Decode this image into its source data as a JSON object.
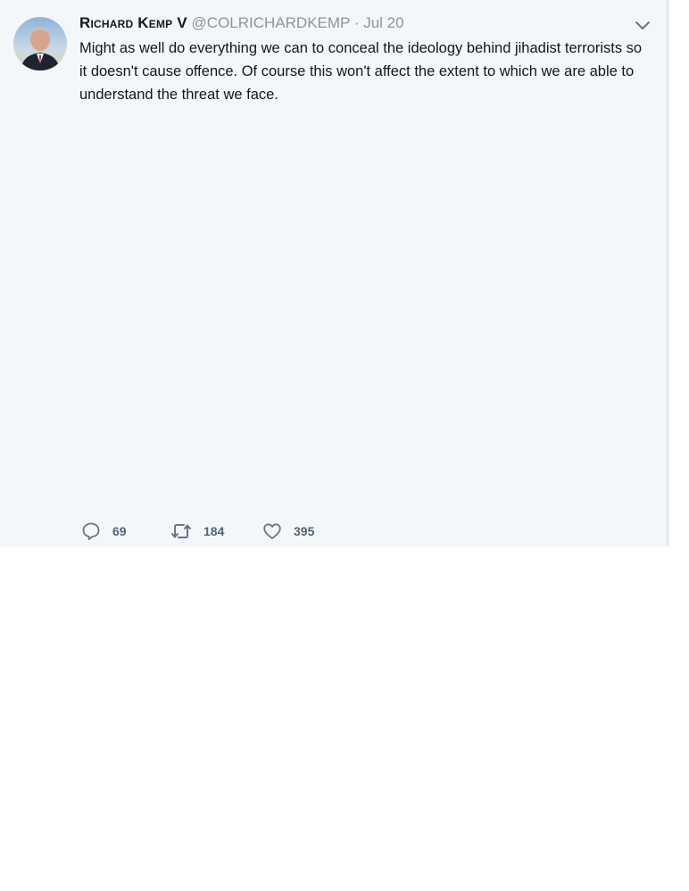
{
  "tweet": {
    "display_name": "Richard Kemp V",
    "screen_name": "@COLRICHARDKEMP",
    "separator": "·",
    "date": "Jul 20",
    "text": "Might as well do everything we can to conceal the ideology behind jihadist terrorists so it doesn't cause offence. Of course this won't affect the extent to which we are able to understand the threat we face.",
    "avatar_icon": "profile-photo",
    "menu_icon": "chevron-down-icon"
  },
  "actions": {
    "reply": {
      "icon": "reply-icon",
      "count": "69"
    },
    "retweet": {
      "icon": "retweet-icon",
      "count": "184"
    },
    "like": {
      "icon": "heart-icon",
      "count": "395"
    }
  },
  "colors": {
    "card_background": "#f3f7fa",
    "text_primary": "#14171a",
    "text_secondary": "#8a959e",
    "icon_gray": "#657786"
  }
}
